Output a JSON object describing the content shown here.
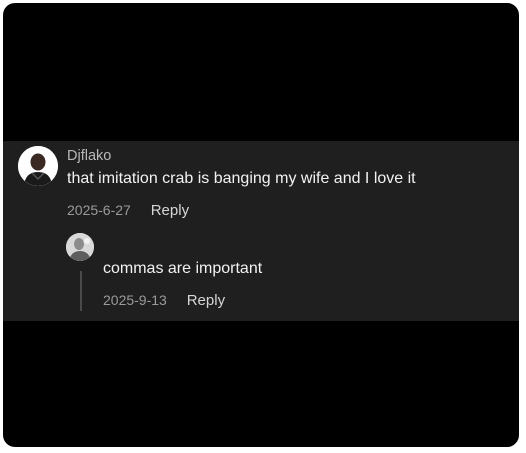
{
  "comment": {
    "username": "Djflako",
    "text": "that imitation crab is banging my wife and I love it",
    "date": "2025-6-27",
    "reply_label": "Reply"
  },
  "reply": {
    "text": "commas are important",
    "date": "2025-9-13",
    "reply_label": "Reply"
  },
  "colors": {
    "background": "#000000",
    "panel": "#1f1f1f",
    "text": "#f2f2f2",
    "muted": "#9a9a9a"
  }
}
